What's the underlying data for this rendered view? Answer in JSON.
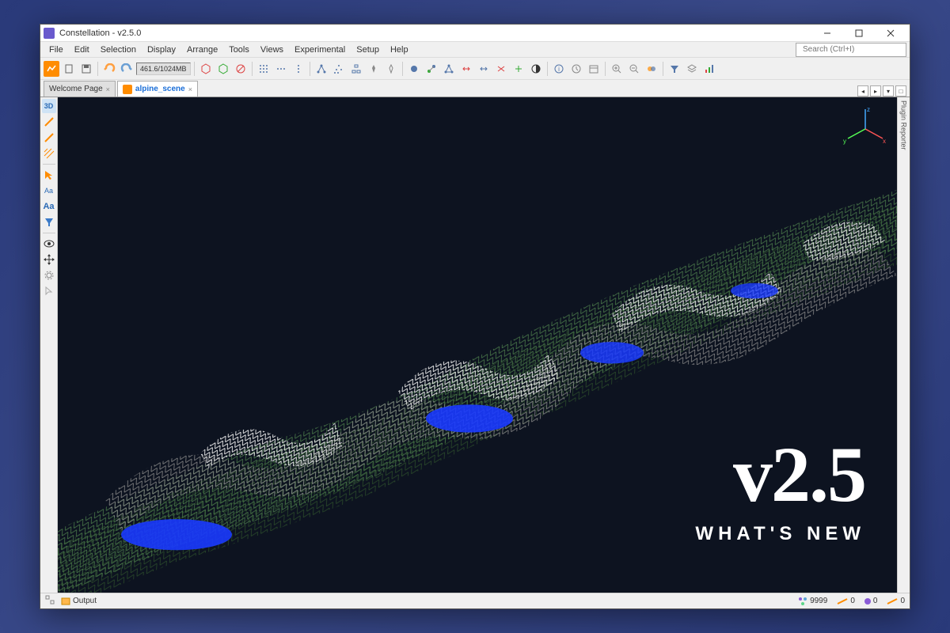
{
  "window": {
    "title": "Constellation - v2.5.0"
  },
  "menubar": [
    "File",
    "Edit",
    "Selection",
    "Display",
    "Arrange",
    "Tools",
    "Views",
    "Experimental",
    "Setup",
    "Help"
  ],
  "toolbar": {
    "memory": "461.6/1024MB"
  },
  "search": {
    "placeholder": "Search (Ctrl+I)"
  },
  "tabs": [
    {
      "label": "Welcome Page",
      "active": false
    },
    {
      "label": "alpine_scene",
      "active": true
    }
  ],
  "leftRail": {
    "mode3d": "3D",
    "labelA": "Aa",
    "labelA2": "Aa"
  },
  "rightPanel": {
    "label": "Plugin Reporter"
  },
  "overlay": {
    "version": "v2.5",
    "subtitle": "WHAT'S NEW"
  },
  "status": {
    "output": "Output",
    "nodes": {
      "count": "9999",
      "color": "#8a5cd6"
    },
    "edges": {
      "count": "0",
      "color": "#ff8c00"
    },
    "sel1": {
      "count": "0",
      "color": "#8a5cd6"
    },
    "sel2": {
      "count": "0",
      "color": "#ff8c00"
    }
  },
  "colors": {
    "accent": "#ff8c00",
    "undo": "#ff9f40",
    "redo": "#6a9fd4"
  }
}
